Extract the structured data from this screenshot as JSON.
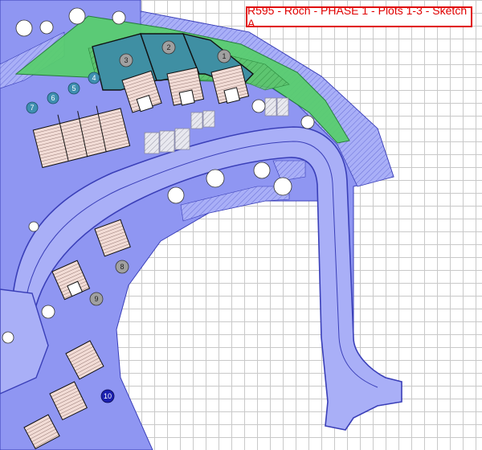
{
  "title": "R595 - Roch - PHASE 1 - Plots 1-3 - Sketch A",
  "plots": {
    "p1": "1",
    "p2": "2",
    "p3": "3",
    "p4": "4",
    "p5": "5",
    "p6": "6",
    "p7": "7",
    "p8": "8",
    "p9": "9",
    "p10": "10"
  },
  "colors": {
    "site_fill": "#8f96f2",
    "road_fill": "#a9aff7",
    "road_edge": "#3a3fb8",
    "phase_green": "#4fd06a",
    "plot_teal": "#3f8fb0",
    "title_red": "#e00000"
  }
}
